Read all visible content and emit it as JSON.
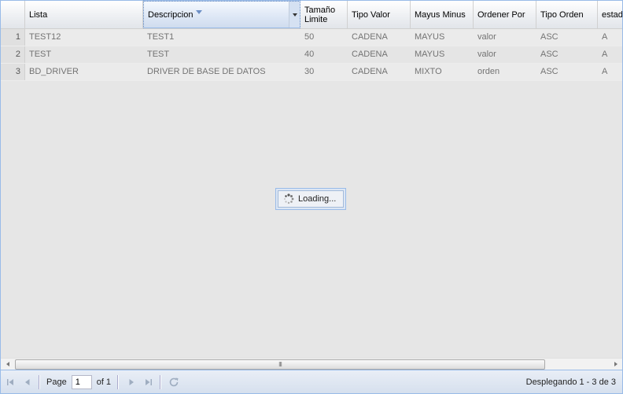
{
  "columns": [
    {
      "label": "Lista",
      "width": 150
    },
    {
      "label": "Descripcion",
      "width": 200,
      "sorted": "desc"
    },
    {
      "label": "Tamaño\nLimite",
      "width": 60
    },
    {
      "label": "Tipo Valor",
      "width": 80
    },
    {
      "label": "Mayus Minus",
      "width": 80
    },
    {
      "label": "Ordener Por",
      "width": 80
    },
    {
      "label": "Tipo Orden",
      "width": 78
    },
    {
      "label": "estad",
      "width": 60
    }
  ],
  "rows": [
    {
      "num": "1",
      "cells": [
        "TEST12",
        "TEST1",
        "50",
        "CADENA",
        "MAYUS",
        "valor",
        "ASC",
        "A"
      ]
    },
    {
      "num": "2",
      "cells": [
        "TEST",
        "TEST",
        "40",
        "CADENA",
        "MAYUS",
        "valor",
        "ASC",
        "A"
      ]
    },
    {
      "num": "3",
      "cells": [
        "BD_DRIVER",
        "DRIVER DE BASE DE DATOS",
        "30",
        "CADENA",
        "MIXTO",
        "orden",
        "ASC",
        "A"
      ]
    }
  ],
  "loading": {
    "text": "Loading..."
  },
  "scrollbar": {
    "thumb_grip": "III"
  },
  "pager": {
    "page_label": "Page",
    "page_value": "1",
    "of_label": "of 1",
    "display_msg": "Desplegando 1 - 3 de 3"
  },
  "colors": {
    "accent": "#99bbe8",
    "active_header": "#dfe8f6",
    "mask_background": "#e6e6e6"
  }
}
